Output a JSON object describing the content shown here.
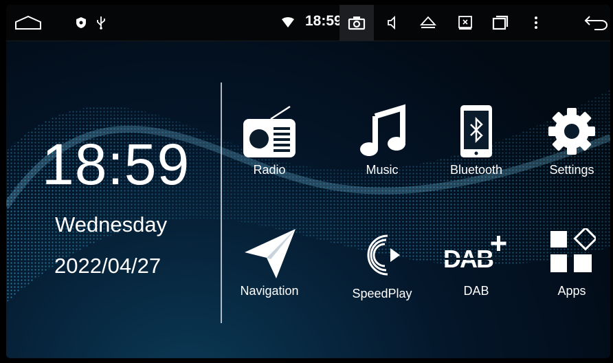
{
  "status_bar": {
    "time": "18:59",
    "icons": [
      "home-icon",
      "shield-icon",
      "usb-icon",
      "wifi-icon",
      "camera-icon",
      "volume-icon",
      "eject-icon",
      "screenshot-icon",
      "recents-icon",
      "more-icon",
      "back-icon"
    ]
  },
  "clock": {
    "time": "18:59",
    "day": "Wednesday",
    "date": "2022/04/27"
  },
  "apps": [
    {
      "label": "Radio",
      "icon": "radio-icon"
    },
    {
      "label": "Music",
      "icon": "music-icon"
    },
    {
      "label": "Bluetooth",
      "icon": "bluetooth-phone-icon"
    },
    {
      "label": "Settings",
      "icon": "gear-icon"
    },
    {
      "label": "Navigation",
      "icon": "paper-plane-icon"
    },
    {
      "label": "SpeedPlay",
      "icon": "speedplay-icon"
    },
    {
      "label": "DAB",
      "icon": "dab-plus-icon"
    },
    {
      "label": "Apps",
      "icon": "apps-grid-icon"
    }
  ],
  "colors": {
    "background": "#04162a",
    "accent_dots": "#1e88b8",
    "text": "#ffffff"
  }
}
